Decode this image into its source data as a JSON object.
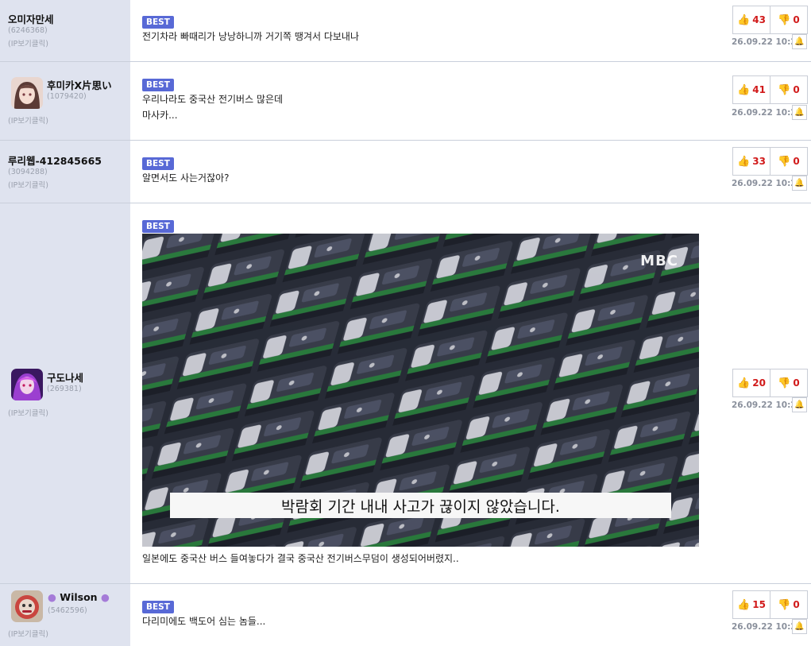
{
  "comments": [
    {
      "username": "오미자만세",
      "user_id": "(6246368)",
      "ip_label": "(IP보기클릭)",
      "best_label": "BEST",
      "text_lines": [
        "전기차라 빠때리가 낭낭하니까 거기쪽 땡겨서 다보내나"
      ],
      "likes": "43",
      "dislikes": "0",
      "date": "26.09.22 10:21"
    },
    {
      "username": "후미카X片思い",
      "user_id": "(1079420)",
      "ip_label": "(IP보기클릭)",
      "best_label": "BEST",
      "text_lines": [
        "우리나라도 중국산 전기버스 많은데",
        "마사카..."
      ],
      "likes": "41",
      "dislikes": "0",
      "date": "26.09.22 10:23"
    },
    {
      "username": "루리웹-412845665",
      "user_id": "(3094288)",
      "ip_label": "(IP보기클릭)",
      "best_label": "BEST",
      "text_lines": [
        "알면서도 사는거잖아?"
      ],
      "likes": "33",
      "dislikes": "0",
      "date": "26.09.22 10:22"
    },
    {
      "username": "구도나세",
      "user_id": "(269381)",
      "ip_label": "(IP보기클릭)",
      "best_label": "BEST",
      "image_caption": "박람회 기간 내내 사고가 끊이지 않았습니다.",
      "image_logo": "MBC",
      "text_lines": [
        "일본에도 중국산 버스 들여놓다가 결국 중국산 전기버스무덤이 생성되어버렸지.."
      ],
      "likes": "20",
      "dislikes": "0",
      "date": "26.09.22 10:23"
    },
    {
      "username": "Wilson",
      "user_id": "(5462596)",
      "ip_label": "(IP보기클릭)",
      "best_label": "BEST",
      "text_lines": [
        "다리미에도 백도어 심는 놈들..."
      ],
      "likes": "15",
      "dislikes": "0",
      "date": "26.09.22 10:22"
    }
  ],
  "icons": {
    "like": "thumbs-up-icon",
    "dislike": "thumbs-down-icon",
    "report": "bell-icon"
  },
  "colors": {
    "best_badge": "#5869d6",
    "vote_count": "#d11a1a",
    "thumb": "#2d6fd6",
    "sidebar": "#dfe3ef"
  }
}
